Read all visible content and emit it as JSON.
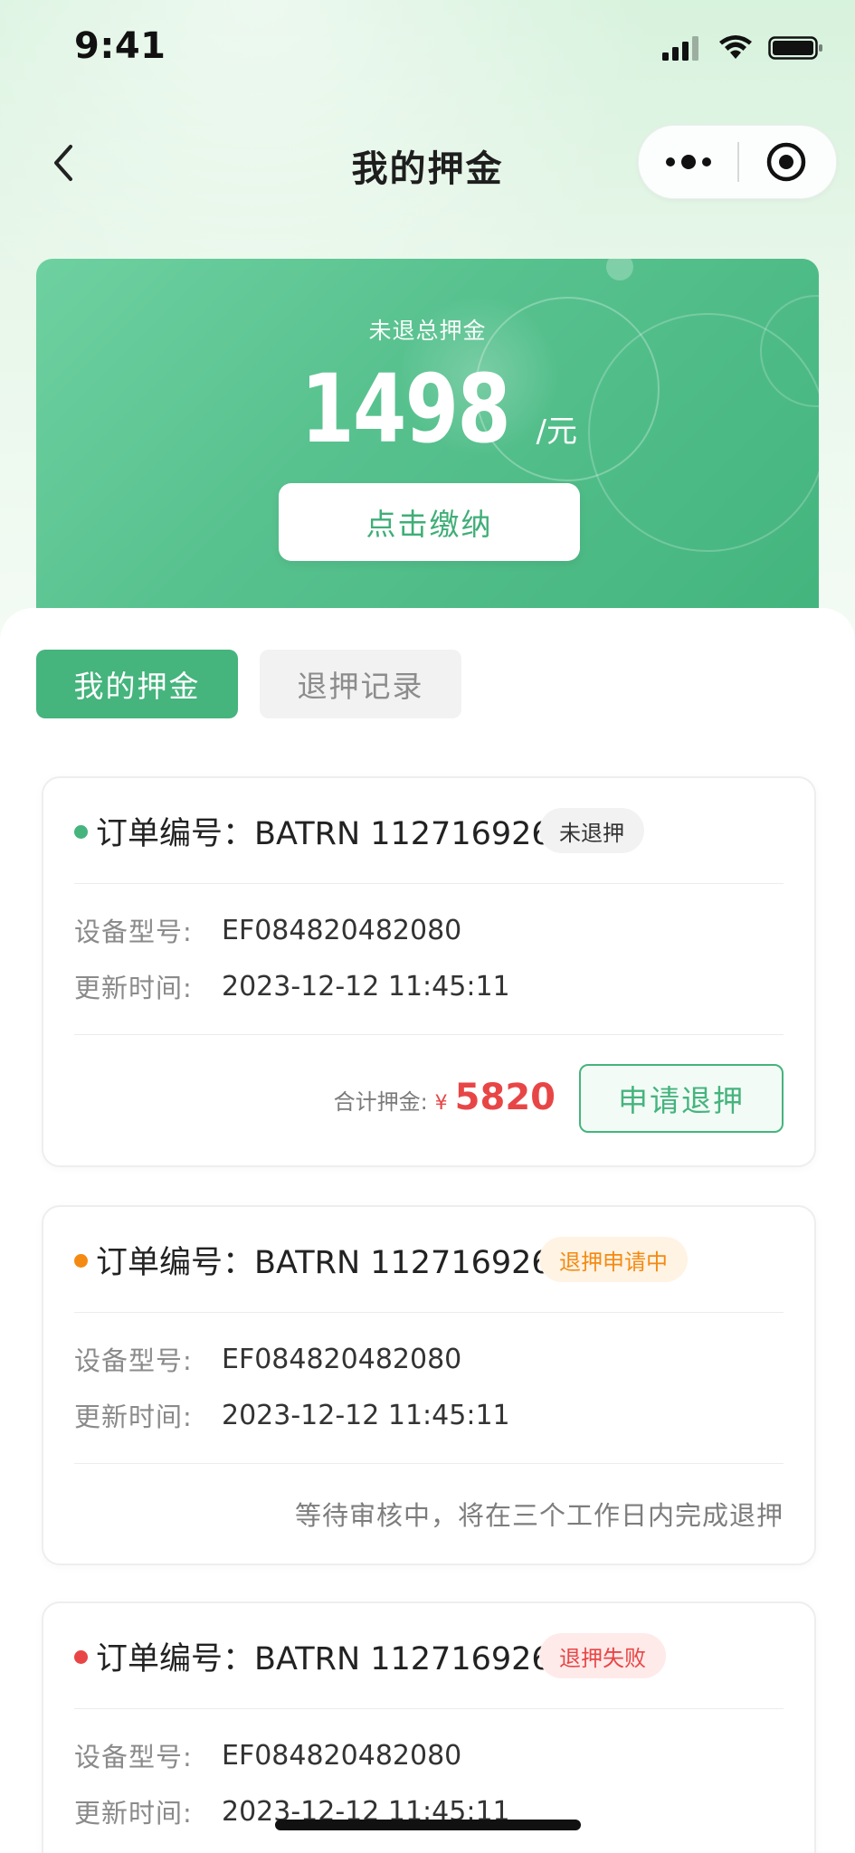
{
  "status_bar": {
    "time": "9:41",
    "icons": [
      "signal-icon",
      "wifi-icon",
      "battery-icon"
    ]
  },
  "nav": {
    "title": "我的押金",
    "back_icon": "back-icon",
    "more_icon": "more-icon",
    "close_icon": "close-icon"
  },
  "summary": {
    "label": "未退总押金",
    "amount": "1498",
    "unit": "/元",
    "pay_button": "点击缴纳"
  },
  "tabs": [
    {
      "label": "我的押金",
      "active": true
    },
    {
      "label": "退押记录",
      "active": false
    }
  ],
  "orders": [
    {
      "order_prefix": "订单编号：",
      "order_no": "BATRN 112716926",
      "status": "未退押",
      "status_color": "#8a8a8a",
      "device_label": "设备型号:",
      "device_value": "EF084820482080",
      "time_label": "更新时间:",
      "time_value": "2023-12-12 11:45:11",
      "total_label": "合计押金:",
      "currency": "¥",
      "total_amount": "5820",
      "action_button": "申请退押"
    },
    {
      "order_prefix": "订单编号：",
      "order_no": "BATRN 112716926",
      "status": "退押申请中",
      "status_color": "#f48a12",
      "device_label": "设备型号:",
      "device_value": "EF084820482080",
      "time_label": "更新时间:",
      "time_value": "2023-12-12 11:45:11",
      "note": "等待审核中，将在三个工作日内完成退押"
    },
    {
      "order_prefix": "订单编号：",
      "order_no": "BATRN 112716926",
      "status": "退押失败",
      "status_color": "#e84646",
      "device_label": "设备型号:",
      "device_value": "EF084820482080",
      "time_label": "更新时间:",
      "time_value": "2023-12-12 11:45:11"
    }
  ],
  "colors": {
    "brand_green": "#45b47d",
    "price_red": "#e84646",
    "pending_orange": "#f48a12",
    "dot_green": "#45b47d"
  }
}
